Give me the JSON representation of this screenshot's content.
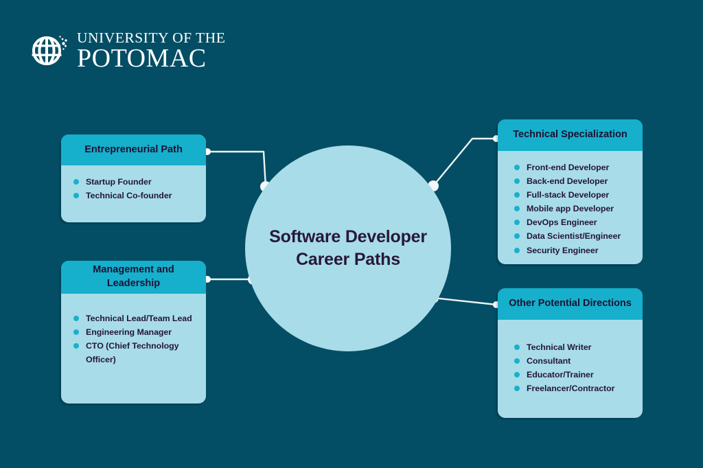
{
  "background_color": "#034E64",
  "accent_teal": "#16AFCC",
  "light_blue": "#A8DCE8",
  "text_dark": "#241636",
  "logo": {
    "icon": "globe-icon",
    "line1": "UNIVERSITY OF THE",
    "line2": "POTOMAC"
  },
  "center": {
    "title": "Software Developer Career Paths"
  },
  "cards": [
    {
      "id": "entrepreneurial",
      "title": "Entrepreneurial Path",
      "items": [
        "Startup Founder",
        "Technical Co-founder"
      ]
    },
    {
      "id": "management",
      "title": "Management and Leadership",
      "items": [
        "Technical Lead/Team Lead",
        "Engineering Manager",
        "CTO (Chief Technology Officer)"
      ]
    },
    {
      "id": "technical",
      "title": "Technical Specialization",
      "items": [
        "Front-end Developer",
        "Back-end Developer",
        "Full-stack Developer",
        "Mobile app Developer",
        "DevOps Engineer",
        "Data Scientist/Engineer",
        "Security Engineer"
      ]
    },
    {
      "id": "other",
      "title": "Other Potential Directions",
      "items": [
        "Technical Writer",
        "Consultant",
        "Educator/Trainer",
        "Freelancer/Contractor"
      ]
    }
  ]
}
